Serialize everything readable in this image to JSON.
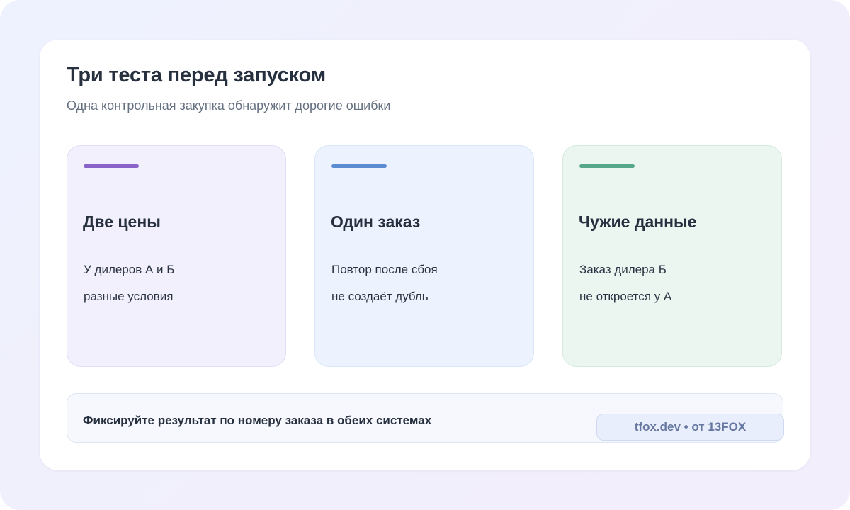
{
  "header": {
    "title": "Три теста перед запуском",
    "subtitle": "Одна контрольная закупка обнаружит дорогие ошибки"
  },
  "cards": [
    {
      "title": "Две цены",
      "lines": [
        "У дилеров А и Б",
        "разные условия"
      ],
      "accent_color": "#8a63c9"
    },
    {
      "title": "Один заказ",
      "lines": [
        "Повтор после сбоя",
        "не создаёт дубль"
      ],
      "accent_color": "#5b8bd0"
    },
    {
      "title": "Чужие данные",
      "lines": [
        "Заказ дилера Б",
        "не откроется у А"
      ],
      "accent_color": "#57a78a"
    }
  ],
  "footer": {
    "text": "Фиксируйте результат по номеру заказа в обеих системах",
    "credit": "tfox.dev • от 13FOX"
  }
}
